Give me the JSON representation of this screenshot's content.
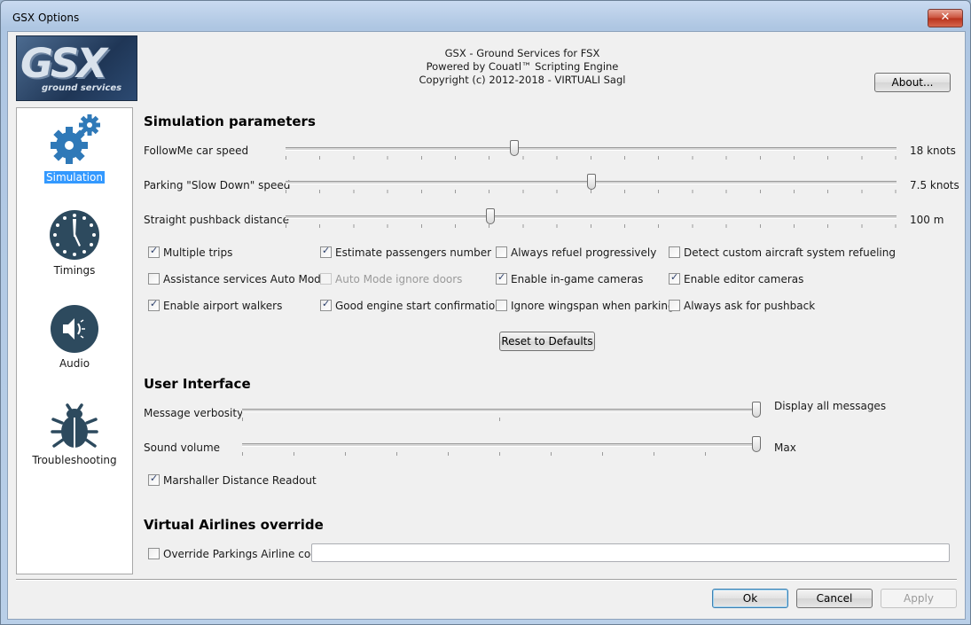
{
  "window": {
    "title": "GSX Options",
    "close_glyph": "✕"
  },
  "logo": {
    "main": "GSX",
    "sub": "ground services"
  },
  "header": {
    "line1": "GSX - Ground Services for FSX",
    "line2": "Powered by Couatl™ Scripting Engine",
    "line3": "Copyright (c) 2012-2018 - VIRTUALI Sagl"
  },
  "about_button": "About...",
  "sidebar": {
    "items": [
      {
        "label": "Simulation",
        "icon": "gears-icon",
        "selected": true
      },
      {
        "label": "Timings",
        "icon": "clock-icon",
        "selected": false
      },
      {
        "label": "Audio",
        "icon": "speaker-icon",
        "selected": false
      },
      {
        "label": "Troubleshooting",
        "icon": "bug-icon",
        "selected": false
      }
    ]
  },
  "simulation": {
    "title": "Simulation parameters",
    "sliders": [
      {
        "label": "FollowMe car speed",
        "value_text": "18 knots",
        "position": 0.375
      },
      {
        "label": "Parking \"Slow Down\" speed",
        "value_text": "7.5 knots",
        "position": 0.5
      },
      {
        "label": "Straight pushback distance",
        "value_text": "100 m",
        "position": 0.335
      }
    ],
    "checkboxes": [
      {
        "label": "Multiple trips",
        "checked": true,
        "enabled": true
      },
      {
        "label": "Estimate passengers number",
        "checked": true,
        "enabled": true
      },
      {
        "label": "Always refuel progressively",
        "checked": false,
        "enabled": true
      },
      {
        "label": "Detect custom aircraft system refueling",
        "checked": false,
        "enabled": true
      },
      {
        "label": "Assistance services Auto Mode",
        "checked": false,
        "enabled": true
      },
      {
        "label": "Auto Mode ignore doors",
        "checked": false,
        "enabled": false
      },
      {
        "label": "Enable in-game cameras",
        "checked": true,
        "enabled": true
      },
      {
        "label": "Enable editor cameras",
        "checked": true,
        "enabled": true
      },
      {
        "label": "Enable airport walkers",
        "checked": true,
        "enabled": true
      },
      {
        "label": "Good engine start confirmation",
        "checked": true,
        "enabled": true
      },
      {
        "label": "Ignore wingspan when parking",
        "checked": false,
        "enabled": true
      },
      {
        "label": "Always ask for pushback",
        "checked": false,
        "enabled": true
      }
    ],
    "reset_button": "Reset to Defaults"
  },
  "user_interface": {
    "title": "User Interface",
    "sliders": [
      {
        "label": "Message verbosity",
        "value_text": "Display all messages",
        "position": 1.0
      },
      {
        "label": "Sound volume",
        "value_text": "Max",
        "position": 1.0
      }
    ],
    "marshaller_checkbox": {
      "label": "Marshaller Distance Readout",
      "checked": true
    }
  },
  "virtual_airlines": {
    "title": "Virtual Airlines override",
    "override_checkbox": {
      "label": "Override Parkings Airline codes",
      "checked": false
    },
    "airline_codes_value": ""
  },
  "footer": {
    "ok": "Ok",
    "cancel": "Cancel",
    "apply": "Apply"
  }
}
